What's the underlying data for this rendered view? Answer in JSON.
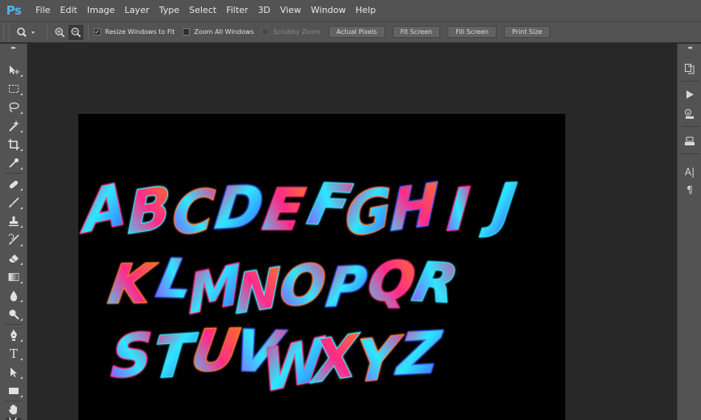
{
  "app": {
    "logo": "Ps"
  },
  "menu": [
    "File",
    "Edit",
    "Image",
    "Layer",
    "Type",
    "Select",
    "Filter",
    "3D",
    "View",
    "Window",
    "Help"
  ],
  "options": {
    "tool_icon": "zoom-tool-icon",
    "zoom_in_icon": "zoom-in-icon",
    "zoom_out_icon": "zoom-out-icon",
    "resize_windows": {
      "label": "Resize Windows to Fit",
      "checked": true
    },
    "zoom_all_windows": {
      "label": "Zoom All Windows",
      "checked": false
    },
    "scrubby_zoom": {
      "label": "Scrubby Zoom",
      "checked": false,
      "disabled": true
    },
    "buttons": [
      "Actual Pixels",
      "Fit Screen",
      "Fill Screen",
      "Print Size"
    ]
  },
  "toolbar": {
    "tools": [
      "move-tool",
      "marquee-tool",
      "lasso-tool",
      "quick-selection-tool",
      "crop-tool",
      "eyedropper-tool",
      "healing-brush-tool",
      "brush-tool",
      "clone-stamp-tool",
      "history-brush-tool",
      "eraser-tool",
      "gradient-tool",
      "blur-tool",
      "dodge-tool",
      "pen-tool",
      "type-tool",
      "path-selection-tool",
      "rectangle-tool",
      "hand-tool",
      "zoom-tool"
    ],
    "type_tool_glyph": "T"
  },
  "document": {
    "rows": [
      "ABCDEFGHIJ",
      "KLMNOPQR",
      "STUVWXYZ"
    ],
    "colors": {
      "background": "#000000",
      "magenta": "#ff2a8a",
      "cyan": "#2ee6ff",
      "orange": "#ff7a1a",
      "blue": "#3f5bff",
      "purple": "#9b3dff"
    }
  },
  "right_panel": {
    "icons": [
      "history-icon",
      "play-actions-icon",
      "info-icon",
      "layer-comps-icon",
      "character-icon",
      "paragraph-icon"
    ],
    "character_glyph": "A|",
    "paragraph_glyph": "¶"
  }
}
